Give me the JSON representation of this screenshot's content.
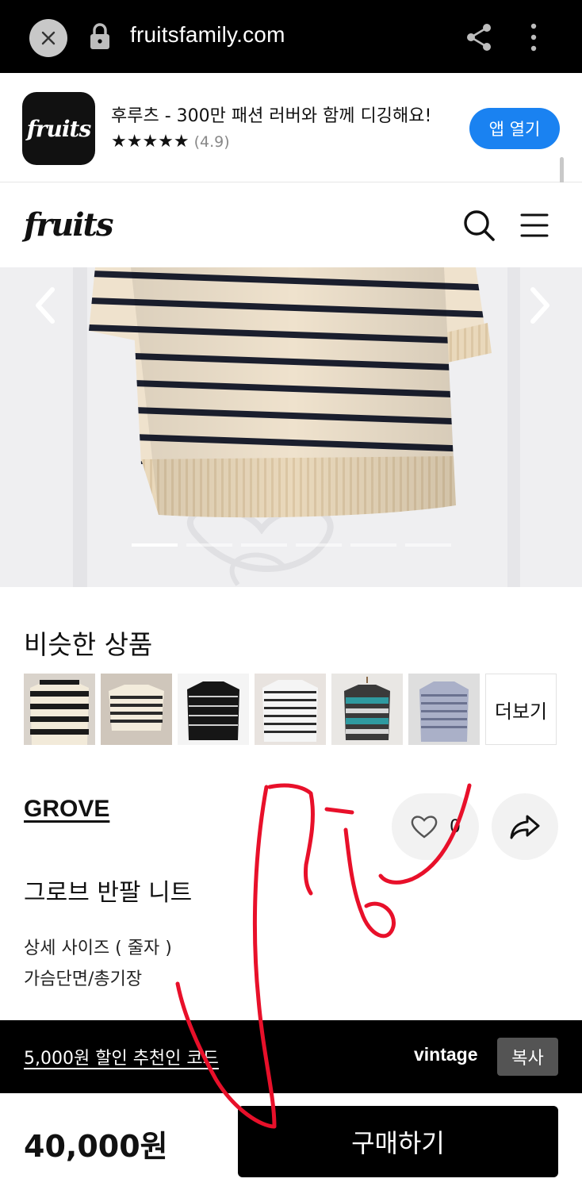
{
  "browser": {
    "url": "fruitsfamily.com",
    "icons": [
      "close-icon",
      "lock-icon",
      "share-icon",
      "more-vert-icon"
    ]
  },
  "app_banner": {
    "icon_text": "fruits",
    "title": "후루츠 - 300만 패션 러버와 함께 디깅해요!",
    "stars": "★★★★★",
    "score": "(4.9)",
    "open_label": "앱 열기",
    "accent": "#1a82f1"
  },
  "site_header": {
    "logo": "fruits",
    "icons": [
      "search-icon",
      "menu-icon"
    ]
  },
  "gallery": {
    "slide_count": 6,
    "active_slide": 1,
    "icons": [
      "chevron-left-icon",
      "chevron-right-icon"
    ]
  },
  "similar": {
    "title": "비슷한 상품",
    "more_label": "더보기"
  },
  "product": {
    "brand": "GROVE",
    "like_count": "0",
    "name": "그로브 반팔 니트",
    "desc_line1": "상세 사이즈 ( 줄자 )",
    "desc_line2": "가슴단면/총기장"
  },
  "promo": {
    "text": "5,000원 할인 추천인 코드",
    "code": "vintage",
    "copy_label": "복사"
  },
  "purchase": {
    "price": "40,000원",
    "buy_label": "구매하기"
  },
  "colors": {
    "scribble": "#e8102a",
    "knit_base": "#efe2cd",
    "stripe": "#1b1f2e"
  }
}
